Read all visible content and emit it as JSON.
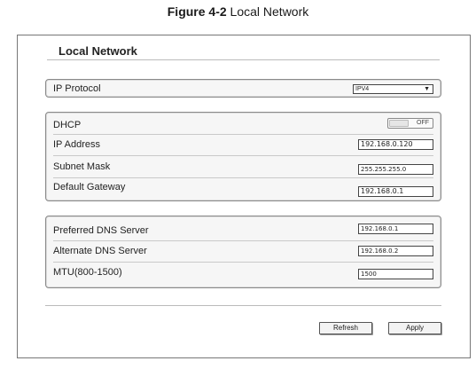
{
  "caption": {
    "figure": "Figure 4-2",
    "title": "Local Network"
  },
  "panel": {
    "title": "Local Network"
  },
  "ip_protocol": {
    "label": "IP Protocol",
    "value": "IPV4",
    "arrow": "▼"
  },
  "dhcp": {
    "label": "DHCP",
    "toggle_text": "OFF"
  },
  "ip_address": {
    "label": "IP Address",
    "value": "192.168.0.120"
  },
  "subnet_mask": {
    "label": "Subnet Mask",
    "value": "255.255.255.0"
  },
  "gateway": {
    "label": "Default Gateway",
    "value": "192.168.0.1"
  },
  "preferred_dns": {
    "label": "Preferred DNS Server",
    "value": "192.168.0.1"
  },
  "alternate_dns": {
    "label": "Alternate DNS Server",
    "value": "192.168.0.2"
  },
  "mtu": {
    "label": "MTU(800-1500)",
    "value": "1500"
  },
  "buttons": {
    "refresh": "Refresh",
    "apply": "Apply"
  }
}
